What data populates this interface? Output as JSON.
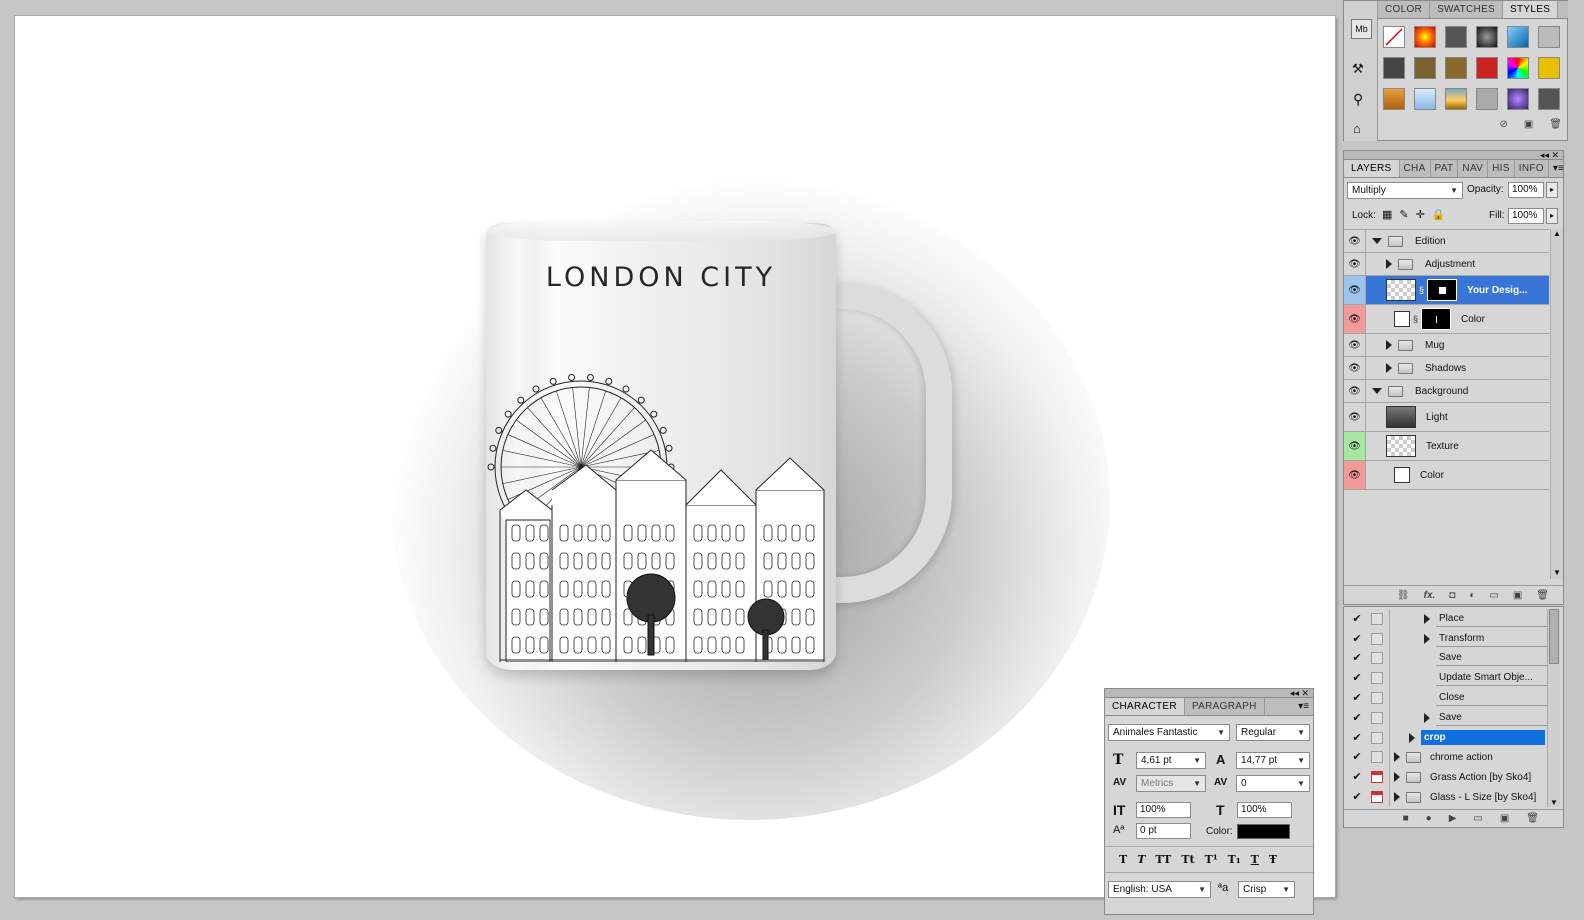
{
  "canvas": {
    "mug_text": "LONDON CITY"
  },
  "styles_panel": {
    "tabs": [
      "COLOR",
      "SWATCHES",
      "STYLES"
    ],
    "active_tab": "STYLES",
    "side_tool_label": "Mb"
  },
  "layers_panel": {
    "tabs": [
      "LAYERS",
      "CHA",
      "PAT",
      "NAV",
      "HIS",
      "INFO"
    ],
    "blend_mode": "Multiply",
    "opacity_label": "Opacity:",
    "opacity_value": "100%",
    "lock_label": "Lock:",
    "fill_label": "Fill:",
    "fill_value": "100%",
    "layers": [
      {
        "name": "Edition",
        "type": "group",
        "expanded": true,
        "indent": 0,
        "color": "none"
      },
      {
        "name": "Adjustment",
        "type": "group",
        "expanded": false,
        "indent": 1,
        "color": "none"
      },
      {
        "name": "Your Desig...",
        "type": "smart",
        "indent": 1,
        "selected": true,
        "color": "blue"
      },
      {
        "name": "Color",
        "type": "fill",
        "indent": 1,
        "color": "red"
      },
      {
        "name": "Mug",
        "type": "group",
        "expanded": false,
        "indent": 1,
        "color": "none"
      },
      {
        "name": "Shadows",
        "type": "group",
        "expanded": false,
        "indent": 1,
        "color": "none"
      },
      {
        "name": "Background",
        "type": "group",
        "expanded": true,
        "indent": 0,
        "color": "none"
      },
      {
        "name": "Light",
        "type": "layer",
        "indent": 1,
        "color": "none"
      },
      {
        "name": "Texture",
        "type": "smart",
        "indent": 1,
        "color": "green"
      },
      {
        "name": "Color",
        "type": "layer",
        "indent": 1,
        "color": "red"
      }
    ]
  },
  "actions_panel": {
    "items": [
      {
        "name": "Place",
        "expandable": true,
        "indent": 2
      },
      {
        "name": "Transform",
        "expandable": true,
        "indent": 2
      },
      {
        "name": "Save",
        "expandable": false,
        "indent": 2
      },
      {
        "name": "Update Smart Obje...",
        "expandable": false,
        "indent": 2
      },
      {
        "name": "Close",
        "expandable": false,
        "indent": 2
      },
      {
        "name": "Save",
        "expandable": true,
        "indent": 2
      },
      {
        "name": "crop",
        "expandable": true,
        "indent": 1,
        "selected": true
      },
      {
        "name": "chrome action",
        "expandable": true,
        "indent": 0,
        "folder": true
      },
      {
        "name": "Grass Action [by Sko4]",
        "expandable": true,
        "indent": 0,
        "folder": true,
        "dialog": true
      },
      {
        "name": "Glass - L Size [by Sko4]",
        "expandable": true,
        "indent": 0,
        "folder": true,
        "dialog": true
      }
    ]
  },
  "character_panel": {
    "tabs": [
      "CHARACTER",
      "PARAGRAPH"
    ],
    "font_family": "Animales Fantastic",
    "font_style": "Regular",
    "font_size": "4,61 pt",
    "leading": "14,77 pt",
    "kerning": "Metrics",
    "tracking": "0",
    "vertical_scale": "100%",
    "horizontal_scale": "100%",
    "baseline_shift": "0 pt",
    "color_label": "Color:",
    "text_color": "#000000",
    "style_buttons": [
      "T",
      "T",
      "TT",
      "Tt",
      "T¹",
      "T₁",
      "T",
      "Ŧ"
    ],
    "language": "English: USA",
    "aa_glyph": "ªa",
    "antialias": "Crisp"
  }
}
